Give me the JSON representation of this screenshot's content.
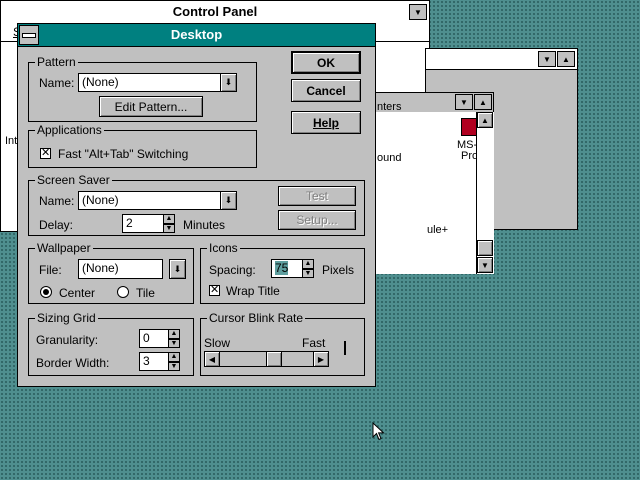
{
  "control_panel": {
    "title": "Control Panel",
    "menu_first": "S",
    "icon_labels": [
      "Inte",
      "nters",
      "ound",
      "MS-",
      "Pro",
      "ule+"
    ]
  },
  "desktop": {
    "title": "Desktop",
    "buttons": {
      "ok": "OK",
      "cancel": "Cancel",
      "help": "Help",
      "test": "Test",
      "setup": "Setup..."
    },
    "pattern": {
      "group": "Pattern",
      "name_label": "Name:",
      "name_value": "(None)",
      "edit_button": "Edit Pattern..."
    },
    "applications": {
      "group": "Applications",
      "fast_switch_label": "Fast \"Alt+Tab\" Switching",
      "fast_switch_checked": true
    },
    "screen_saver": {
      "group": "Screen Saver",
      "name_label": "Name:",
      "name_value": "(None)",
      "delay_label": "Delay:",
      "delay_value": "2",
      "delay_units": "Minutes"
    },
    "wallpaper": {
      "group": "Wallpaper",
      "file_label": "File:",
      "file_value": "(None)",
      "center_label": "Center",
      "tile_label": "Tile",
      "selected": "Center"
    },
    "icons": {
      "group": "Icons",
      "spacing_label": "Spacing:",
      "spacing_value": "75",
      "spacing_units": "Pixels",
      "wrap_label": "Wrap Title",
      "wrap_checked": true
    },
    "sizing_grid": {
      "group": "Sizing Grid",
      "granularity_label": "Granularity:",
      "granularity_value": "0",
      "border_label": "Border Width:",
      "border_value": "3"
    },
    "cursor_blink": {
      "group": "Cursor Blink Rate",
      "slow_label": "Slow",
      "fast_label": "Fast",
      "rate_fraction": 0.6
    }
  },
  "colors": {
    "desktop_bg": "#4f8f8f",
    "title_active": "#008080",
    "dialog_bg": "#c0c0c0"
  }
}
